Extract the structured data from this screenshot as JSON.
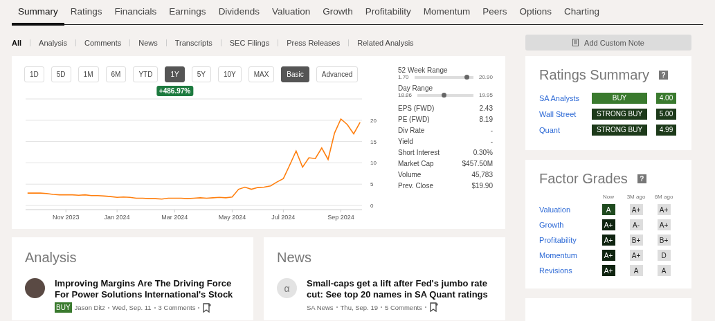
{
  "tabs": [
    {
      "label": "Summary",
      "selected": true
    },
    {
      "label": "Ratings",
      "selected": false
    },
    {
      "label": "Financials",
      "selected": false
    },
    {
      "label": "Earnings",
      "selected": false
    },
    {
      "label": "Dividends",
      "selected": false
    },
    {
      "label": "Valuation",
      "selected": false
    },
    {
      "label": "Growth",
      "selected": false
    },
    {
      "label": "Profitability",
      "selected": false
    },
    {
      "label": "Momentum",
      "selected": false
    },
    {
      "label": "Peers",
      "selected": false
    },
    {
      "label": "Options",
      "selected": false
    },
    {
      "label": "Charting",
      "selected": false
    }
  ],
  "filters": [
    {
      "label": "All",
      "selected": true
    },
    {
      "label": "Analysis",
      "selected": false
    },
    {
      "label": "Comments",
      "selected": false
    },
    {
      "label": "News",
      "selected": false
    },
    {
      "label": "Transcripts",
      "selected": false
    },
    {
      "label": "SEC Filings",
      "selected": false
    },
    {
      "label": "Press Releases",
      "selected": false
    },
    {
      "label": "Related Analysis",
      "selected": false
    }
  ],
  "add_note_button": "Add Custom Note",
  "chart_panel": {
    "periods": [
      {
        "label": "1D",
        "selected": false
      },
      {
        "label": "5D",
        "selected": false
      },
      {
        "label": "1M",
        "selected": false
      },
      {
        "label": "6M",
        "selected": false
      },
      {
        "label": "YTD",
        "selected": false
      },
      {
        "label": "1Y",
        "selected": true
      },
      {
        "label": "5Y",
        "selected": false
      },
      {
        "label": "10Y",
        "selected": false
      },
      {
        "label": "MAX",
        "selected": false
      }
    ],
    "modes": [
      {
        "label": "Basic",
        "selected": true
      },
      {
        "label": "Advanced",
        "selected": false
      }
    ],
    "change": "+486.97%",
    "chart_data": {
      "type": "line",
      "categories": [
        null,
        null,
        null,
        null,
        null,
        null,
        "Nov 2023",
        null,
        null,
        null,
        null,
        null,
        null,
        null,
        "Jan 2024",
        null,
        null,
        null,
        null,
        null,
        null,
        null,
        null,
        "Mar 2024",
        null,
        null,
        null,
        null,
        null,
        null,
        null,
        null,
        "May 2024",
        null,
        null,
        null,
        null,
        null,
        null,
        null,
        "Jul 2024",
        null,
        null,
        null,
        null,
        null,
        null,
        null,
        null,
        "Sep 2024",
        null,
        null,
        null
      ],
      "series": [
        {
          "color": "#ff7f0e",
          "values": [
            2.9,
            2.9,
            2.9,
            2.8,
            2.6,
            2.5,
            2.5,
            2.5,
            2.4,
            2.5,
            2.3,
            2.3,
            2.2,
            2.1,
            1.9,
            2.0,
            1.9,
            1.7,
            1.7,
            1.6,
            1.6,
            1.5,
            1.7,
            1.7,
            1.7,
            1.6,
            1.7,
            1.8,
            1.7,
            1.8,
            1.9,
            1.8,
            2.0,
            3.8,
            4.3,
            3.8,
            4.2,
            4.3,
            4.6,
            5.5,
            6.3,
            9.5,
            12.8,
            9.0,
            11.2,
            11.0,
            13.5,
            10.8,
            17.0,
            20.3,
            19.0,
            16.8,
            19.5
          ]
        }
      ],
      "ylim": [
        0,
        25
      ],
      "grid": true,
      "yticks": [
        0,
        5,
        10,
        15,
        20
      ]
    },
    "ranges": [
      {
        "title": "52 Week Range",
        "low": "1.70",
        "high": "20.90",
        "level": 0.88
      },
      {
        "title": "Day Range",
        "low": "18.86",
        "high": "19.95",
        "level": 0.47
      }
    ],
    "stats": [
      {
        "label": "EPS (FWD)",
        "value": "2.43"
      },
      {
        "label": "PE (FWD)",
        "value": "8.19"
      },
      {
        "label": "Div Rate",
        "value": "-"
      },
      {
        "label": "Yield",
        "value": "-"
      },
      {
        "label": "Short Interest",
        "value": "0.30%"
      },
      {
        "label": "Market Cap",
        "value": "$457.50M"
      },
      {
        "label": "Volume",
        "value": "45,783"
      },
      {
        "label": "Prev. Close",
        "value": "$19.90"
      }
    ]
  },
  "ratings_summary": {
    "title": "Ratings Summary",
    "help": "?",
    "rows": [
      {
        "source": "SA Analysts",
        "rating": "BUY",
        "score": "4.00",
        "color": "#3a7a2e"
      },
      {
        "source": "Wall Street",
        "rating": "STRONG BUY",
        "score": "5.00",
        "color": "#1d3a1a"
      },
      {
        "source": "Quant",
        "rating": "STRONG BUY",
        "score": "4.99",
        "color": "#1d3a1a"
      }
    ]
  },
  "factor_grades": {
    "title": "Factor Grades",
    "help": "?",
    "columns": [
      "Now",
      "3M ago",
      "6M ago"
    ],
    "rows": [
      {
        "factor": "Valuation",
        "grades": [
          {
            "grade": "A",
            "color": "#1f4a1f"
          },
          {
            "grade": "A+",
            "color": "#dddddd"
          },
          {
            "grade": "A+",
            "color": "#dddddd"
          }
        ]
      },
      {
        "factor": "Growth",
        "grades": [
          {
            "grade": "A+",
            "color": "#0f2410"
          },
          {
            "grade": "A-",
            "color": "#dddddd"
          },
          {
            "grade": "A+",
            "color": "#dddddd"
          }
        ]
      },
      {
        "factor": "Profitability",
        "grades": [
          {
            "grade": "A+",
            "color": "#0f2410"
          },
          {
            "grade": "B+",
            "color": "#dddddd"
          },
          {
            "grade": "B+",
            "color": "#dddddd"
          }
        ]
      },
      {
        "factor": "Momentum",
        "grades": [
          {
            "grade": "A+",
            "color": "#0f2410"
          },
          {
            "grade": "A+",
            "color": "#dddddd"
          },
          {
            "grade": "D",
            "color": "#dddddd"
          }
        ]
      },
      {
        "factor": "Revisions",
        "grades": [
          {
            "grade": "A+",
            "color": "#0f2410"
          },
          {
            "grade": "A",
            "color": "#dddddd"
          },
          {
            "grade": "A",
            "color": "#dddddd"
          }
        ]
      }
    ]
  },
  "analysis": {
    "title": "Analysis",
    "articles": [
      {
        "kind": "avatar",
        "title": "Improving Margins Are The Driving Force For Power Solutions International's Stock",
        "badge": "BUY",
        "author": "Jason Ditz",
        "date": "Wed, Sep. 11",
        "comments": "3 Comments"
      }
    ]
  },
  "news": {
    "title": "News",
    "articles": [
      {
        "kind": "alpha",
        "icon": "α",
        "title": "Small-caps get a lift after Fed's jumbo rate cut: See top 20 names in SA Quant ratings",
        "author": "SA News",
        "date": "Thu, Sep. 19",
        "comments": "5 Comments"
      }
    ]
  }
}
